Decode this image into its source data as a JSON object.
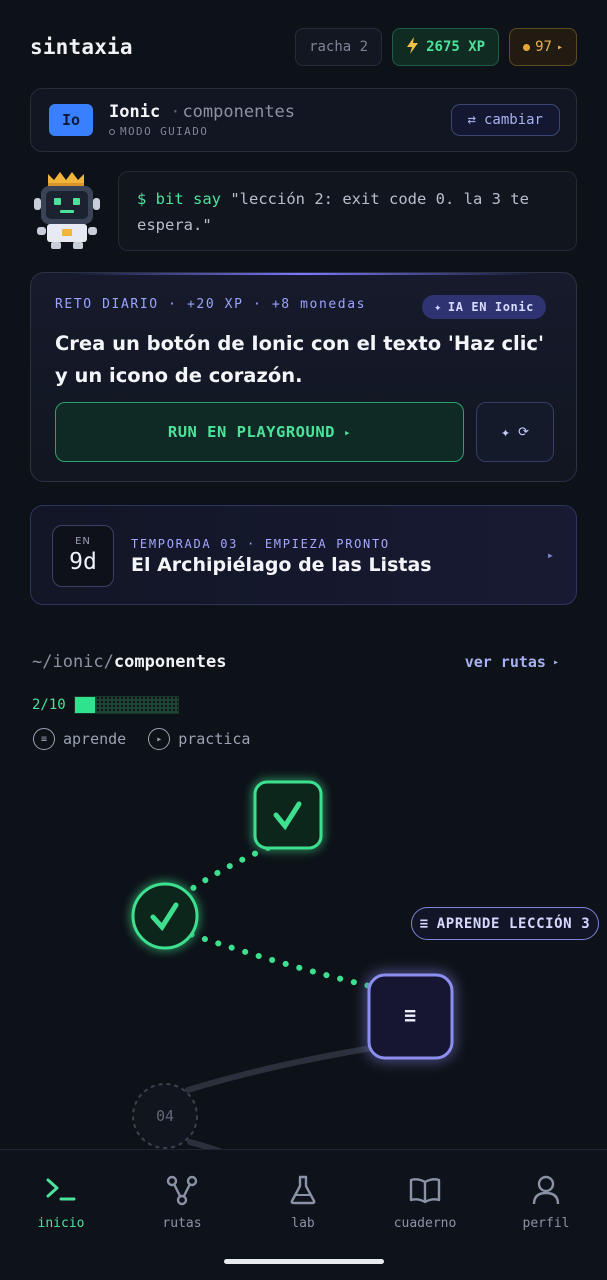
{
  "header": {
    "logo": "sintaxia",
    "streak": "racha 2",
    "xp": "2675 XP",
    "coins": "97",
    "coins_arrow": "▸"
  },
  "tech": {
    "badge": "Io",
    "name": "Ionic",
    "sub": "componentes",
    "mode": "MODO GUIADO",
    "switch_label": "cambiar",
    "switch_icon": "⇄"
  },
  "speech": {
    "prompt": "$ bit say",
    "message": "\"lección 2: exit code 0. la 3 te espera.\""
  },
  "challenge": {
    "meta": "RETO DIARIO · +20 XP · +8 monedas",
    "ai_badge": "IA EN Ionic",
    "title": "Crea un botón de Ionic con el texto 'Haz clic' y un icono de corazón.",
    "run_label": "RUN EN PLAYGROUND",
    "run_arrow": "▸"
  },
  "season": {
    "prefix": "EN",
    "days": "9d",
    "label": "TEMPORADA 03 · EMPIEZA PRONTO",
    "title": "El Archipiélago de las Listas",
    "arrow": "▸"
  },
  "path": {
    "prefix": "~/ionic/",
    "name": "componentes",
    "link": "ver rutas",
    "link_arrow": "▸",
    "progress_text": "2/10",
    "progress": 0.2,
    "modes": [
      {
        "icon": "≡",
        "label": "aprende"
      },
      {
        "icon": "▸",
        "label": "practica"
      }
    ],
    "nodes": [
      {
        "state": "done"
      },
      {
        "state": "done"
      },
      {
        "state": "current",
        "icon": "≡"
      },
      {
        "state": "locked",
        "label": "04"
      }
    ],
    "tooltip_icon": "≡",
    "tooltip": "APRENDE LECCIÓN 3"
  },
  "nav": {
    "items": [
      {
        "label": "inicio",
        "icon": "terminal-icon"
      },
      {
        "label": "rutas",
        "icon": "routes-icon"
      },
      {
        "label": "lab",
        "icon": "flask-icon"
      },
      {
        "label": "cuaderno",
        "icon": "book-icon"
      },
      {
        "label": "perfil",
        "icon": "user-icon"
      }
    ],
    "active": "inicio"
  },
  "colors": {
    "accent_green": "#4ce29a",
    "accent_purple": "#a7b1f2",
    "background": "#0d1118",
    "ionic_blue": "#3880ff"
  }
}
